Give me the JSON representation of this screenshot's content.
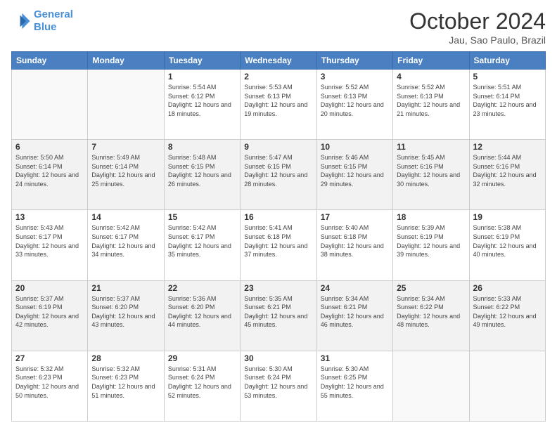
{
  "header": {
    "logo_line1": "General",
    "logo_line2": "Blue",
    "month": "October 2024",
    "location": "Jau, Sao Paulo, Brazil"
  },
  "weekdays": [
    "Sunday",
    "Monday",
    "Tuesday",
    "Wednesday",
    "Thursday",
    "Friday",
    "Saturday"
  ],
  "weeks": [
    [
      {
        "day": "",
        "info": ""
      },
      {
        "day": "",
        "info": ""
      },
      {
        "day": "1",
        "info": "Sunrise: 5:54 AM\nSunset: 6:12 PM\nDaylight: 12 hours and 18 minutes."
      },
      {
        "day": "2",
        "info": "Sunrise: 5:53 AM\nSunset: 6:13 PM\nDaylight: 12 hours and 19 minutes."
      },
      {
        "day": "3",
        "info": "Sunrise: 5:52 AM\nSunset: 6:13 PM\nDaylight: 12 hours and 20 minutes."
      },
      {
        "day": "4",
        "info": "Sunrise: 5:52 AM\nSunset: 6:13 PM\nDaylight: 12 hours and 21 minutes."
      },
      {
        "day": "5",
        "info": "Sunrise: 5:51 AM\nSunset: 6:14 PM\nDaylight: 12 hours and 23 minutes."
      }
    ],
    [
      {
        "day": "6",
        "info": "Sunrise: 5:50 AM\nSunset: 6:14 PM\nDaylight: 12 hours and 24 minutes."
      },
      {
        "day": "7",
        "info": "Sunrise: 5:49 AM\nSunset: 6:14 PM\nDaylight: 12 hours and 25 minutes."
      },
      {
        "day": "8",
        "info": "Sunrise: 5:48 AM\nSunset: 6:15 PM\nDaylight: 12 hours and 26 minutes."
      },
      {
        "day": "9",
        "info": "Sunrise: 5:47 AM\nSunset: 6:15 PM\nDaylight: 12 hours and 28 minutes."
      },
      {
        "day": "10",
        "info": "Sunrise: 5:46 AM\nSunset: 6:15 PM\nDaylight: 12 hours and 29 minutes."
      },
      {
        "day": "11",
        "info": "Sunrise: 5:45 AM\nSunset: 6:16 PM\nDaylight: 12 hours and 30 minutes."
      },
      {
        "day": "12",
        "info": "Sunrise: 5:44 AM\nSunset: 6:16 PM\nDaylight: 12 hours and 32 minutes."
      }
    ],
    [
      {
        "day": "13",
        "info": "Sunrise: 5:43 AM\nSunset: 6:17 PM\nDaylight: 12 hours and 33 minutes."
      },
      {
        "day": "14",
        "info": "Sunrise: 5:42 AM\nSunset: 6:17 PM\nDaylight: 12 hours and 34 minutes."
      },
      {
        "day": "15",
        "info": "Sunrise: 5:42 AM\nSunset: 6:17 PM\nDaylight: 12 hours and 35 minutes."
      },
      {
        "day": "16",
        "info": "Sunrise: 5:41 AM\nSunset: 6:18 PM\nDaylight: 12 hours and 37 minutes."
      },
      {
        "day": "17",
        "info": "Sunrise: 5:40 AM\nSunset: 6:18 PM\nDaylight: 12 hours and 38 minutes."
      },
      {
        "day": "18",
        "info": "Sunrise: 5:39 AM\nSunset: 6:19 PM\nDaylight: 12 hours and 39 minutes."
      },
      {
        "day": "19",
        "info": "Sunrise: 5:38 AM\nSunset: 6:19 PM\nDaylight: 12 hours and 40 minutes."
      }
    ],
    [
      {
        "day": "20",
        "info": "Sunrise: 5:37 AM\nSunset: 6:19 PM\nDaylight: 12 hours and 42 minutes."
      },
      {
        "day": "21",
        "info": "Sunrise: 5:37 AM\nSunset: 6:20 PM\nDaylight: 12 hours and 43 minutes."
      },
      {
        "day": "22",
        "info": "Sunrise: 5:36 AM\nSunset: 6:20 PM\nDaylight: 12 hours and 44 minutes."
      },
      {
        "day": "23",
        "info": "Sunrise: 5:35 AM\nSunset: 6:21 PM\nDaylight: 12 hours and 45 minutes."
      },
      {
        "day": "24",
        "info": "Sunrise: 5:34 AM\nSunset: 6:21 PM\nDaylight: 12 hours and 46 minutes."
      },
      {
        "day": "25",
        "info": "Sunrise: 5:34 AM\nSunset: 6:22 PM\nDaylight: 12 hours and 48 minutes."
      },
      {
        "day": "26",
        "info": "Sunrise: 5:33 AM\nSunset: 6:22 PM\nDaylight: 12 hours and 49 minutes."
      }
    ],
    [
      {
        "day": "27",
        "info": "Sunrise: 5:32 AM\nSunset: 6:23 PM\nDaylight: 12 hours and 50 minutes."
      },
      {
        "day": "28",
        "info": "Sunrise: 5:32 AM\nSunset: 6:23 PM\nDaylight: 12 hours and 51 minutes."
      },
      {
        "day": "29",
        "info": "Sunrise: 5:31 AM\nSunset: 6:24 PM\nDaylight: 12 hours and 52 minutes."
      },
      {
        "day": "30",
        "info": "Sunrise: 5:30 AM\nSunset: 6:24 PM\nDaylight: 12 hours and 53 minutes."
      },
      {
        "day": "31",
        "info": "Sunrise: 5:30 AM\nSunset: 6:25 PM\nDaylight: 12 hours and 55 minutes."
      },
      {
        "day": "",
        "info": ""
      },
      {
        "day": "",
        "info": ""
      }
    ]
  ]
}
